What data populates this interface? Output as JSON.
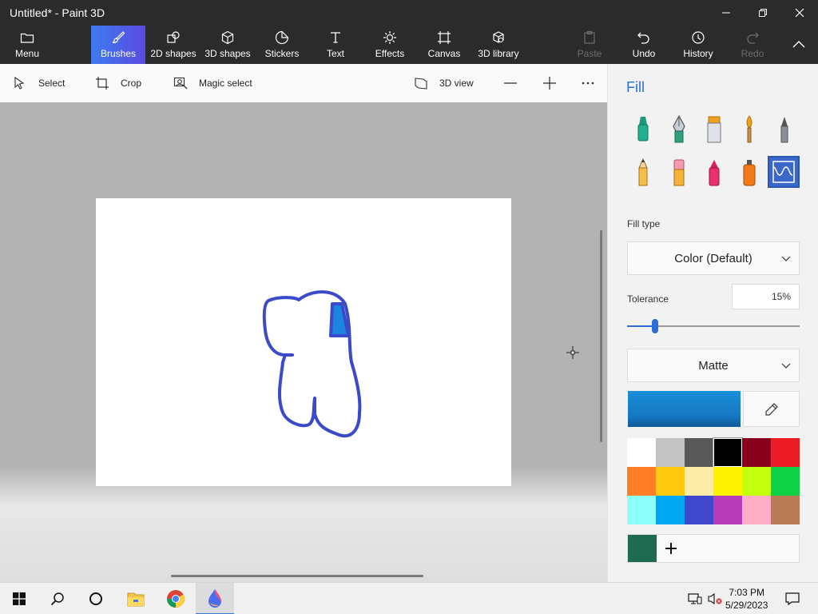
{
  "window": {
    "title": "Untitled* - Paint 3D"
  },
  "ribbon": {
    "menu": "Menu",
    "brushes": "Brushes",
    "shapes2d": "2D shapes",
    "shapes3d": "3D shapes",
    "stickers": "Stickers",
    "text": "Text",
    "effects": "Effects",
    "canvas": "Canvas",
    "library": "3D library",
    "paste": "Paste",
    "undo": "Undo",
    "history": "History",
    "redo": "Redo"
  },
  "toolbar": {
    "select": "Select",
    "crop": "Crop",
    "magic_select": "Magic select",
    "view3d": "3D view"
  },
  "panel": {
    "title": "Fill",
    "fill_type_label": "Fill type",
    "fill_type_value": "Color (Default)",
    "tolerance_label": "Tolerance",
    "tolerance_value": "15%",
    "tolerance_fraction": 0.16,
    "finish_value": "Matte",
    "current_color": "#1a8fd8",
    "custom_color": "#1e6b52",
    "palette": [
      "#ffffff",
      "#c3c3c3",
      "#585858",
      "#000000",
      "#88001b",
      "#ec1c24",
      "#ff7f27",
      "#ffc90e",
      "#fdeca6",
      "#fff200",
      "#c4ff0e",
      "#0ed145",
      "#8cfffb",
      "#00a8f3",
      "#3f48cc",
      "#b83dba",
      "#ffaec8",
      "#b97a56"
    ]
  },
  "taskbar": {
    "time": "7:03 PM",
    "date": "5/29/2023"
  }
}
